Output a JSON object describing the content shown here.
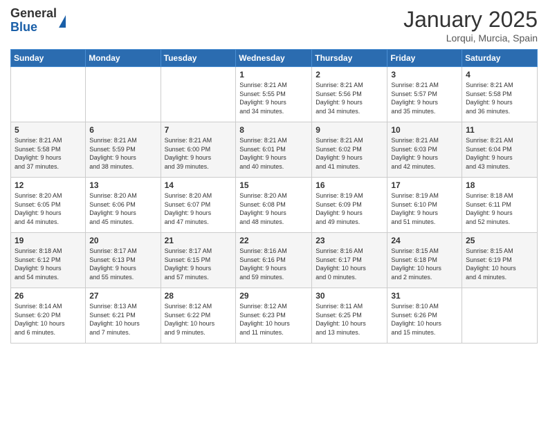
{
  "logo": {
    "general": "General",
    "blue": "Blue"
  },
  "header": {
    "title": "January 2025",
    "location": "Lorqui, Murcia, Spain"
  },
  "weekdays": [
    "Sunday",
    "Monday",
    "Tuesday",
    "Wednesday",
    "Thursday",
    "Friday",
    "Saturday"
  ],
  "weeks": [
    [
      {
        "day": "",
        "info": ""
      },
      {
        "day": "",
        "info": ""
      },
      {
        "day": "",
        "info": ""
      },
      {
        "day": "1",
        "info": "Sunrise: 8:21 AM\nSunset: 5:55 PM\nDaylight: 9 hours\nand 34 minutes."
      },
      {
        "day": "2",
        "info": "Sunrise: 8:21 AM\nSunset: 5:56 PM\nDaylight: 9 hours\nand 34 minutes."
      },
      {
        "day": "3",
        "info": "Sunrise: 8:21 AM\nSunset: 5:57 PM\nDaylight: 9 hours\nand 35 minutes."
      },
      {
        "day": "4",
        "info": "Sunrise: 8:21 AM\nSunset: 5:58 PM\nDaylight: 9 hours\nand 36 minutes."
      }
    ],
    [
      {
        "day": "5",
        "info": "Sunrise: 8:21 AM\nSunset: 5:58 PM\nDaylight: 9 hours\nand 37 minutes."
      },
      {
        "day": "6",
        "info": "Sunrise: 8:21 AM\nSunset: 5:59 PM\nDaylight: 9 hours\nand 38 minutes."
      },
      {
        "day": "7",
        "info": "Sunrise: 8:21 AM\nSunset: 6:00 PM\nDaylight: 9 hours\nand 39 minutes."
      },
      {
        "day": "8",
        "info": "Sunrise: 8:21 AM\nSunset: 6:01 PM\nDaylight: 9 hours\nand 40 minutes."
      },
      {
        "day": "9",
        "info": "Sunrise: 8:21 AM\nSunset: 6:02 PM\nDaylight: 9 hours\nand 41 minutes."
      },
      {
        "day": "10",
        "info": "Sunrise: 8:21 AM\nSunset: 6:03 PM\nDaylight: 9 hours\nand 42 minutes."
      },
      {
        "day": "11",
        "info": "Sunrise: 8:21 AM\nSunset: 6:04 PM\nDaylight: 9 hours\nand 43 minutes."
      }
    ],
    [
      {
        "day": "12",
        "info": "Sunrise: 8:20 AM\nSunset: 6:05 PM\nDaylight: 9 hours\nand 44 minutes."
      },
      {
        "day": "13",
        "info": "Sunrise: 8:20 AM\nSunset: 6:06 PM\nDaylight: 9 hours\nand 45 minutes."
      },
      {
        "day": "14",
        "info": "Sunrise: 8:20 AM\nSunset: 6:07 PM\nDaylight: 9 hours\nand 47 minutes."
      },
      {
        "day": "15",
        "info": "Sunrise: 8:20 AM\nSunset: 6:08 PM\nDaylight: 9 hours\nand 48 minutes."
      },
      {
        "day": "16",
        "info": "Sunrise: 8:19 AM\nSunset: 6:09 PM\nDaylight: 9 hours\nand 49 minutes."
      },
      {
        "day": "17",
        "info": "Sunrise: 8:19 AM\nSunset: 6:10 PM\nDaylight: 9 hours\nand 51 minutes."
      },
      {
        "day": "18",
        "info": "Sunrise: 8:18 AM\nSunset: 6:11 PM\nDaylight: 9 hours\nand 52 minutes."
      }
    ],
    [
      {
        "day": "19",
        "info": "Sunrise: 8:18 AM\nSunset: 6:12 PM\nDaylight: 9 hours\nand 54 minutes."
      },
      {
        "day": "20",
        "info": "Sunrise: 8:17 AM\nSunset: 6:13 PM\nDaylight: 9 hours\nand 55 minutes."
      },
      {
        "day": "21",
        "info": "Sunrise: 8:17 AM\nSunset: 6:15 PM\nDaylight: 9 hours\nand 57 minutes."
      },
      {
        "day": "22",
        "info": "Sunrise: 8:16 AM\nSunset: 6:16 PM\nDaylight: 9 hours\nand 59 minutes."
      },
      {
        "day": "23",
        "info": "Sunrise: 8:16 AM\nSunset: 6:17 PM\nDaylight: 10 hours\nand 0 minutes."
      },
      {
        "day": "24",
        "info": "Sunrise: 8:15 AM\nSunset: 6:18 PM\nDaylight: 10 hours\nand 2 minutes."
      },
      {
        "day": "25",
        "info": "Sunrise: 8:15 AM\nSunset: 6:19 PM\nDaylight: 10 hours\nand 4 minutes."
      }
    ],
    [
      {
        "day": "26",
        "info": "Sunrise: 8:14 AM\nSunset: 6:20 PM\nDaylight: 10 hours\nand 6 minutes."
      },
      {
        "day": "27",
        "info": "Sunrise: 8:13 AM\nSunset: 6:21 PM\nDaylight: 10 hours\nand 7 minutes."
      },
      {
        "day": "28",
        "info": "Sunrise: 8:12 AM\nSunset: 6:22 PM\nDaylight: 10 hours\nand 9 minutes."
      },
      {
        "day": "29",
        "info": "Sunrise: 8:12 AM\nSunset: 6:23 PM\nDaylight: 10 hours\nand 11 minutes."
      },
      {
        "day": "30",
        "info": "Sunrise: 8:11 AM\nSunset: 6:25 PM\nDaylight: 10 hours\nand 13 minutes."
      },
      {
        "day": "31",
        "info": "Sunrise: 8:10 AM\nSunset: 6:26 PM\nDaylight: 10 hours\nand 15 minutes."
      },
      {
        "day": "",
        "info": ""
      }
    ]
  ]
}
